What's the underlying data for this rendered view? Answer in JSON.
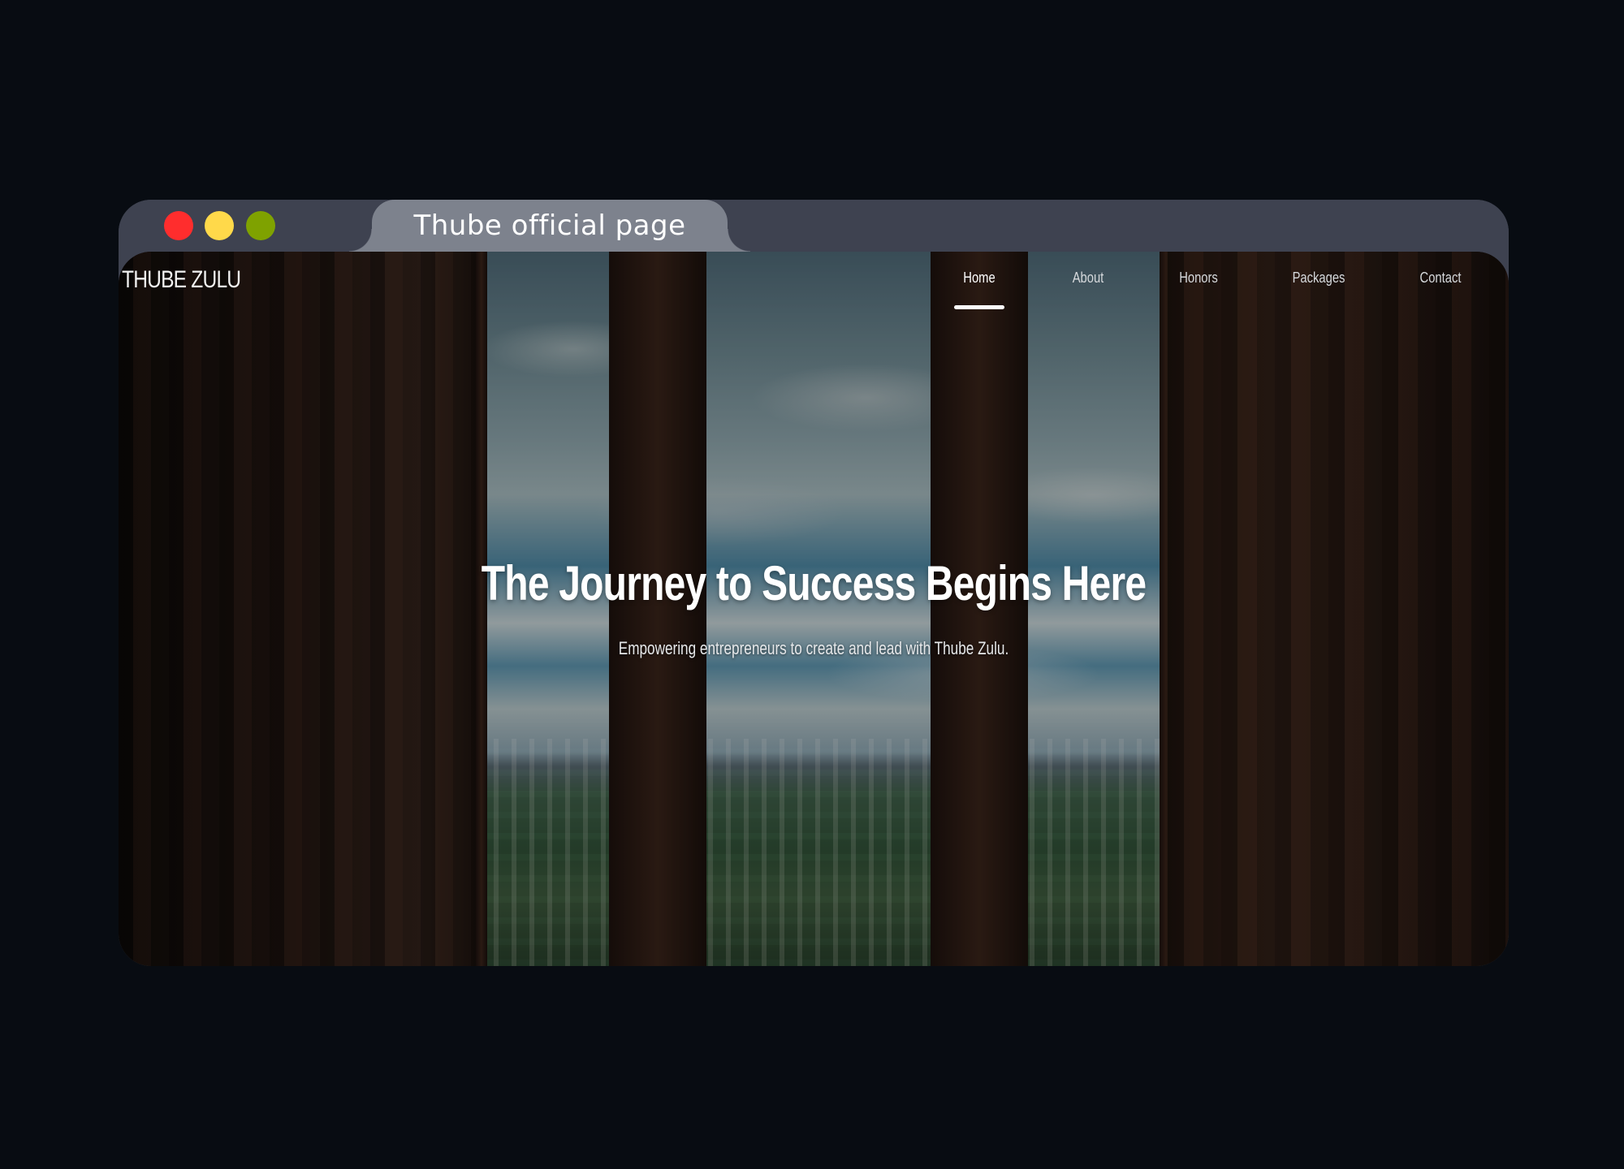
{
  "browser": {
    "tab_title": "Thube official page"
  },
  "site": {
    "logo": "THUBE ZULU",
    "nav": [
      "Home",
      "About",
      "Honors",
      "Packages",
      "Contact"
    ],
    "active_nav": "Home",
    "hero_title": "The Journey to Success Begins Here",
    "hero_subtitle": "Empowering entrepreneurs to create and lead with Thube Zulu."
  },
  "colors": {
    "page_background": "#080c12",
    "chrome": "#3e4250",
    "active_tab": "#7d828d",
    "close_button": "#ff2d2d",
    "minimize_button": "#ffd94a",
    "maximize_button": "#7fa200"
  }
}
